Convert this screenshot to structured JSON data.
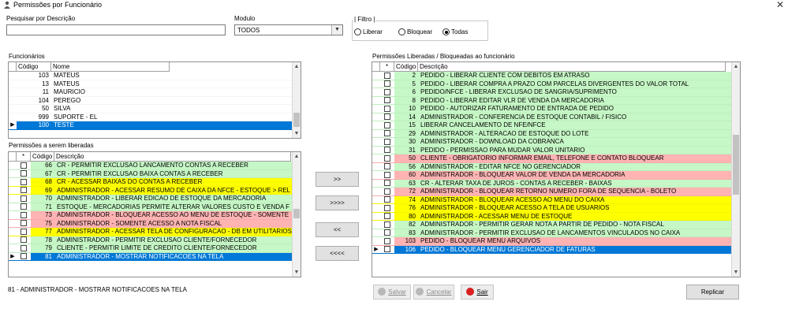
{
  "window": {
    "title": "Permissões por Funcionário",
    "close": "✕"
  },
  "search": {
    "label": "Pesquisar por Descrição",
    "value": ""
  },
  "modulo": {
    "label": "Modulo",
    "selected": "TODOS"
  },
  "filtro": {
    "label": "| Filtro |",
    "options": [
      {
        "label": "Liberar",
        "checked": false
      },
      {
        "label": "Bloquear",
        "checked": false
      },
      {
        "label": "Todas",
        "checked": true
      }
    ]
  },
  "funcionarios": {
    "label": "Funcionários",
    "columns": [
      "Código",
      "Nome"
    ],
    "rows": [
      {
        "code": "103",
        "name": "MATEUS",
        "color": "#ffffff"
      },
      {
        "code": "13",
        "name": "MATEUS",
        "color": "#ffffff"
      },
      {
        "code": "11",
        "name": "MAURICIO",
        "color": "#ffffff"
      },
      {
        "code": "104",
        "name": "PEREGO",
        "color": "#ffffff"
      },
      {
        "code": "50",
        "name": "SILVA",
        "color": "#ffffff"
      },
      {
        "code": "999",
        "name": "SUPORTE - EL",
        "color": "#ffffff"
      },
      {
        "code": "100",
        "name": "TESTE",
        "color": "#0078d7",
        "selected": true
      }
    ]
  },
  "pendentes": {
    "label": "Permissões a serem liberadas",
    "columns": [
      "*",
      "Código",
      "Descrição"
    ],
    "rows": [
      {
        "code": "66",
        "desc": "CR - PERMITIR EXCLUSAO LANCAMENTO CONTAS A RECEBER",
        "color": "#c6f7c6"
      },
      {
        "code": "67",
        "desc": "CR - PERMITIR EXCLUSAO BAIXA CONTAS A RECEBER",
        "color": "#c6f7c6"
      },
      {
        "code": "68",
        "desc": "CR - ACESSAR BAIXAS DO CONTAS A RECEBER",
        "color": "#ffff00"
      },
      {
        "code": "69",
        "desc": "ADMINISTRADOR - ACESSAR RESUMO DE CAIXA DA NFCE - ESTOQUE > REL",
        "color": "#ffff00"
      },
      {
        "code": "70",
        "desc": "ADMINISTRADOR - LIBERAR EDICAO DE ESTOQUE DA MERCADORIA",
        "color": "#c6f7c6"
      },
      {
        "code": "71",
        "desc": "ESTOQUE - MERCADORIAS PERMITE ALTERAR VALORES CUSTO E VENDA F",
        "color": "#c6f7c6"
      },
      {
        "code": "73",
        "desc": "ADMINISTRADOR - BLOQUEAR ACESSO AO MENU DE ESTOQUE - SOMENTE",
        "color": "#ffb3b3"
      },
      {
        "code": "75",
        "desc": "ADMINISTRADOR - SOMENTE ACESSO A NOTA FISCAL",
        "color": "#ffb3b3"
      },
      {
        "code": "77",
        "desc": "ADMINISTRADOR - ACESSAR TELA DE CONFIGURACAO - DB EM UTILITARIOS",
        "color": "#ffff00"
      },
      {
        "code": "78",
        "desc": "ADMINISTRADOR - PERMITIR EXCLUSAO CLIENTE/FORNECEDOR",
        "color": "#c6f7c6"
      },
      {
        "code": "79",
        "desc": "CLIENTE - PERMITIR LIMITE DE CREDITO CLIENTE/FORNECEDOR",
        "color": "#c6f7c6"
      },
      {
        "code": "81",
        "desc": "ADMINISTRADOR - MOSTRAR NOTIFICACOES NA TELA",
        "color": "#0078d7",
        "selected": true
      }
    ]
  },
  "transfer": {
    "add": ">>",
    "add_all": ">>>>",
    "remove": "<<",
    "remove_all": "<<<<"
  },
  "liberadas": {
    "label": "Permissões Liberadas / Bloqueadas ao funcionário",
    "columns": [
      "*",
      "Código",
      "Descrição"
    ],
    "rows": [
      {
        "code": "2",
        "desc": "PEDIDO - LIBERAR CLIENTE COM DEBITOS EM ATRASO",
        "color": "#c6f7c6"
      },
      {
        "code": "5",
        "desc": "PEDIDO - LIBERAR COMPRA A PRAZO COM PARCELAS DIVERGENTES DO VALOR TOTAL",
        "color": "#c6f7c6"
      },
      {
        "code": "6",
        "desc": "PEDIDO/NFCE - LIBERAR EXCLUSAO DE SANGRIA/SUPRIMENTO",
        "color": "#c6f7c6"
      },
      {
        "code": "8",
        "desc": "PEDIDO - LIBERAR EDITAR VLR DE VENDA DA MERCADORIA",
        "color": "#c6f7c6"
      },
      {
        "code": "10",
        "desc": "PEDIDO - AUTORIZAR FATURAMENTO DE ENTRADA DE PEDIDO",
        "color": "#c6f7c6"
      },
      {
        "code": "14",
        "desc": "ADMINISTRADOR - CONFERENCIA DE ESTOQUE CONTABIL / FISICO",
        "color": "#c6f7c6"
      },
      {
        "code": "15",
        "desc": "LIBERAR CANCELAMENTO DE NFE/NFCE",
        "color": "#c6f7c6"
      },
      {
        "code": "29",
        "desc": "ADMINISTRADOR - ALTERACAO DE ESTOQUE DO LOTE",
        "color": "#c6f7c6"
      },
      {
        "code": "30",
        "desc": "ADMINISTRADOR - DOWNLOAD DA COBRANCA",
        "color": "#c6f7c6"
      },
      {
        "code": "31",
        "desc": "PEDIDO - PERMISSAO PARA MUDAR VALOR UNITARIO",
        "color": "#c6f7c6"
      },
      {
        "code": "50",
        "desc": "CLIENTE - OBRIGATORIO INFORMAR EMAIL, TELEFONE E CONTATO BLOQUEAR",
        "color": "#ffb3b3"
      },
      {
        "code": "56",
        "desc": "ADMINISTRADOR - EDITAR NFCE NO GERENCIADOR",
        "color": "#c6f7c6"
      },
      {
        "code": "60",
        "desc": "ADMINISTRADOR - BLOQUEAR VALOR DE VENDA DA MERCADORIA",
        "color": "#ffb3b3"
      },
      {
        "code": "63",
        "desc": "CR - ALTERAR TAXA DE JUROS - CONTAS A RECEBER - BAIXAS",
        "color": "#c6f7c6"
      },
      {
        "code": "72",
        "desc": "ADMINISTRADOR - BLOQUEAR RETORNO NUMERO FORA DE SEQUENCIA - BOLETO",
        "color": "#ffb3b3"
      },
      {
        "code": "74",
        "desc": "ADMINISTRADOR - BLOQUEAR ACESSO AO MENU DO CAIXA",
        "color": "#ffff00"
      },
      {
        "code": "76",
        "desc": "ADMINISTRADOR - BLOQUEAR ACESSO A TELA DE USUARIOS",
        "color": "#ffff00"
      },
      {
        "code": "80",
        "desc": "ADMINISTRADOR - ACESSAR MENU DE ESTOQUE",
        "color": "#ffff00"
      },
      {
        "code": "82",
        "desc": "ADMINISTRADOR - PERMITIR GERAR NOTA A PARTIR DE PEDIDO - NOTA FISCAL",
        "color": "#c6f7c6"
      },
      {
        "code": "83",
        "desc": "ADMINISTRADOR - PERMITIR EXCLUSAO DE LANCAMENTOS VINCULADOS NO CAIXA",
        "color": "#c6f7c6"
      },
      {
        "code": "103",
        "desc": "PEDIDO - BLOQUEAR MENU ARQUIVOS",
        "color": "#ffb3b3"
      },
      {
        "code": "106",
        "desc": "PEDIDO - BLOQUEAR MENU GERENCIADOR DE FATURAS",
        "color": "#0078d7",
        "selected": true
      }
    ]
  },
  "status_text": "81 - ADMINISTRADOR - MOSTRAR NOTIFICACOES NA TELA",
  "actions": {
    "salvar": "Salvar",
    "cancelar": "Cancelar",
    "sair": "Sair",
    "replicar": "Replicar"
  }
}
